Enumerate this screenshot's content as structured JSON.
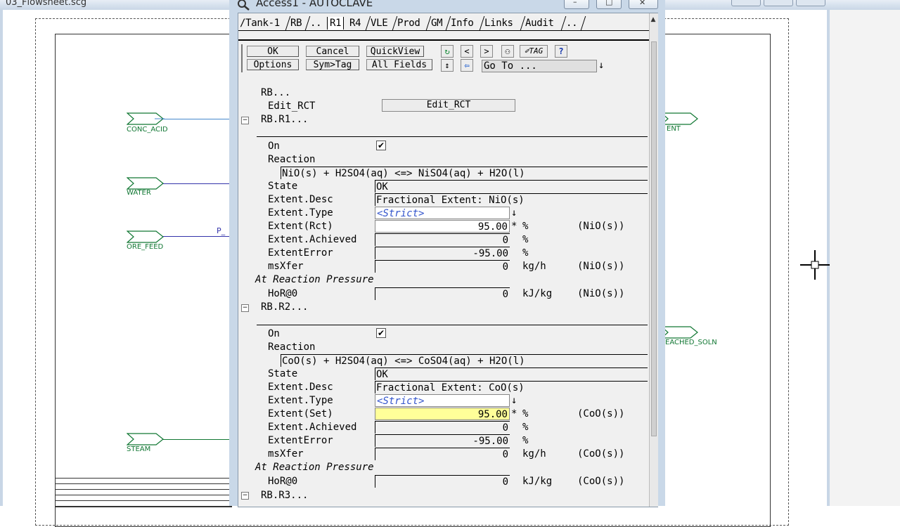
{
  "background": {
    "window_title": "03_Flowsheet.scg",
    "stream_labels": [
      "CONC_ACID",
      "WATER",
      "ORE_FEED",
      "STEAM",
      "ENT",
      "EACHED_SOLN"
    ],
    "pipe_label": "P_"
  },
  "window": {
    "title": "Access1 - AUTOCLAVE",
    "minimize_glyph": "–",
    "maximize_glyph": "□",
    "close_glyph": "✕"
  },
  "tabs": [
    "/Tank-1",
    "RB",
    "..",
    "R1",
    "R4",
    "VLE",
    "Prod",
    "GM",
    "Info",
    "Links",
    "Audit",
    ".."
  ],
  "toolbar": {
    "ok": "OK",
    "cancel": "Cancel",
    "quickview": "QuickView",
    "options": "Options",
    "symtag": "Sym>Tag",
    "allfields": "All Fields",
    "refresh_glyph": "↻",
    "prev": "<",
    "next": ">",
    "binoculars_glyph": "⚇",
    "tag": "✐TAG",
    "help": "?",
    "updown_glyph": "↕",
    "back_glyph": "⇦",
    "goto_text": "Go To ...",
    "goto_arrow": "↓"
  },
  "rb": {
    "header": "RB...",
    "edit_label": "Edit_RCT",
    "edit_button": "Edit_RCT"
  },
  "r1": {
    "header": "RB.R1...",
    "toggle": "−",
    "on_label": "On",
    "check": "✔",
    "reaction_label": "Reaction",
    "reaction": "NiO(s) + H2SO4(aq) <=> NiSO4(aq) + H2O(l)",
    "state_label": "State",
    "state": "OK",
    "ext_desc_label": "Extent.Desc",
    "ext_desc": "Fractional Extent: NiO(s)",
    "ext_type_label": "Extent.Type",
    "ext_type": "<Strict>",
    "ext_type_arrow": "↓",
    "extent_label": "Extent(Rct)",
    "extent_value": "95.00",
    "extent_star": "*",
    "extent_unit": "%",
    "extent_species": "(NiO(s))",
    "achieved_label": "Extent.Achieved",
    "achieved_value": "0",
    "achieved_unit": "%",
    "error_label": "ExtentError",
    "error_value": "-95.00",
    "error_unit": "%",
    "msxfer_label": "msXfer",
    "msxfer_value": "0",
    "msxfer_unit": "kg/h",
    "msxfer_species": "(NiO(s))",
    "pressure_section": "At Reaction Pressure",
    "hor_label": "HoR@0",
    "hor_value": "0",
    "hor_unit": "kJ/kg",
    "hor_species": "(NiO(s))"
  },
  "r2": {
    "header": "RB.R2...",
    "toggle": "−",
    "on_label": "On",
    "check": "✔",
    "reaction_label": "Reaction",
    "reaction": "CoO(s) + H2SO4(aq) <=> CoSO4(aq) + H2O(l)",
    "state_label": "State",
    "state": "OK",
    "ext_desc_label": "Extent.Desc",
    "ext_desc": "Fractional Extent: CoO(s)",
    "ext_type_label": "Extent.Type",
    "ext_type": "<Strict>",
    "ext_type_arrow": "↓",
    "extent_label": "Extent(Set)",
    "extent_value": "95.00",
    "extent_star": "*",
    "extent_unit": "%",
    "extent_species": "(CoO(s))",
    "achieved_label": "Extent.Achieved",
    "achieved_value": "0",
    "achieved_unit": "%",
    "error_label": "ExtentError",
    "error_value": "-95.00",
    "error_unit": "%",
    "msxfer_label": "msXfer",
    "msxfer_value": "0",
    "msxfer_unit": "kg/h",
    "msxfer_species": "(CoO(s))",
    "pressure_section": "At Reaction Pressure",
    "hor_label": "HoR@0",
    "hor_value": "0",
    "hor_unit": "kJ/kg",
    "hor_species": "(CoO(s))"
  },
  "r3": {
    "header": "RB.R3...",
    "toggle": "−"
  },
  "colors": {
    "stream_green": "#117733",
    "highlight_yellow": "#ffff99",
    "strict_blue": "#3355cc"
  }
}
